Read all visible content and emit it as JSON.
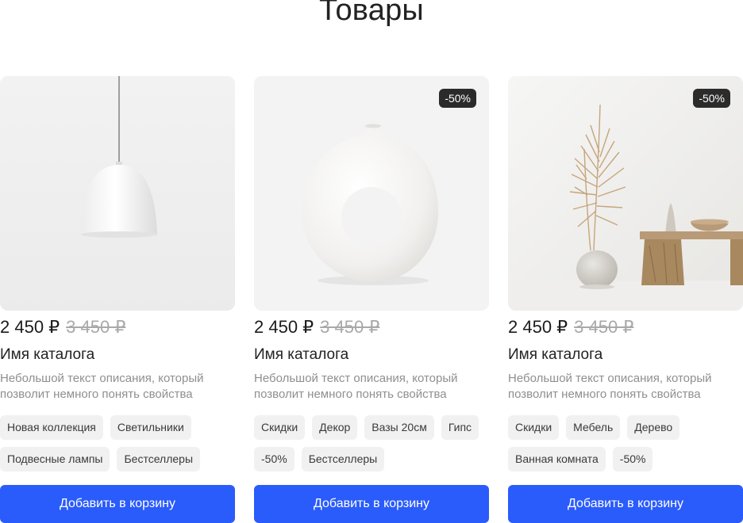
{
  "page": {
    "title": "Товары"
  },
  "products": [
    {
      "image": "pendant-lamp",
      "badge": "",
      "price": "2 450 ₽",
      "old_price": "3 450 ₽",
      "name": "Имя каталога",
      "description": "Небольшой текст описания, который позволит немного понять свойства",
      "tags_row1": [
        "Новая коллекция",
        "Светильники"
      ],
      "tags_row2": [
        "Подвесные лампы",
        "Бестселлеры"
      ],
      "button": "Добавить в корзину"
    },
    {
      "image": "donut-vase",
      "badge": "-50%",
      "price": "2 450 ₽",
      "old_price": "3 450 ₽",
      "name": "Имя каталога",
      "description": "Небольшой текст описания, который позволит немного понять свойства",
      "tags_row1": [
        "Скидки",
        "Декор",
        "Вазы 20см",
        "Гипс"
      ],
      "tags_row2": [
        "-50%",
        "Бестселлеры"
      ],
      "button": "Добавить в корзину"
    },
    {
      "image": "dried-palm-decor",
      "badge": "-50%",
      "price": "2 450 ₽",
      "old_price": "3 450 ₽",
      "name": "Имя каталога",
      "description": "Небольшой текст описания, который позволит немного понять свойства",
      "tags_row1": [
        "Скидки",
        "Мебель",
        "Дерево"
      ],
      "tags_row2": [
        "Ванная комната",
        "-50%"
      ],
      "button": "Добавить в корзину"
    }
  ],
  "colors": {
    "accent": "#2a5bfb",
    "badge": "#2b2b2b",
    "tag_bg": "#f1f1f1"
  }
}
